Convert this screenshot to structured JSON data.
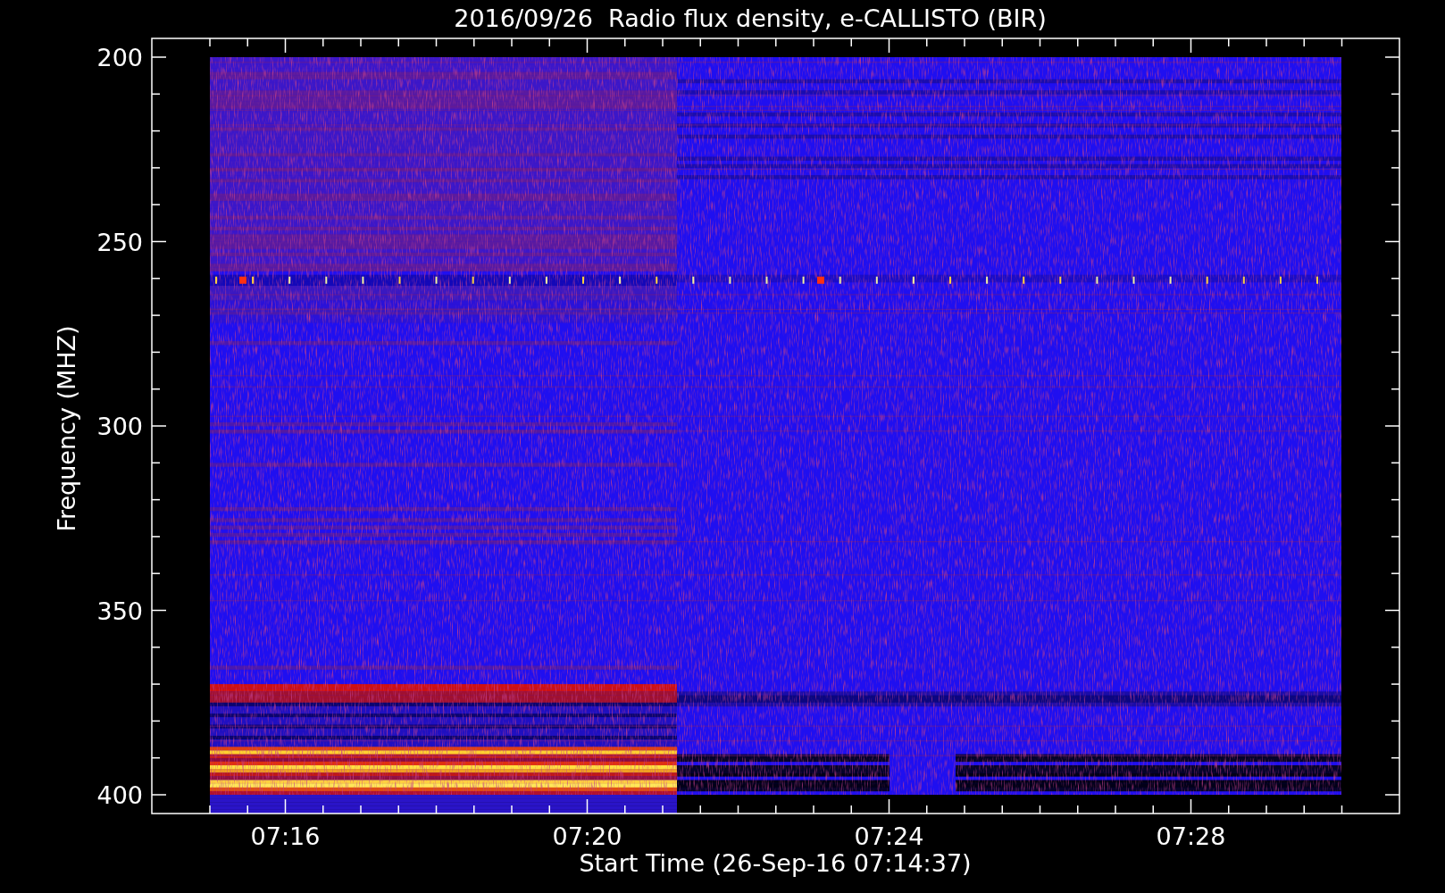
{
  "title": "2016/09/26  Radio flux density, e-CALLISTO (BIR)",
  "yaxis": {
    "label": "Frequency (MHZ)",
    "ticks": [
      "200",
      "250",
      "300",
      "350",
      "400"
    ]
  },
  "xaxis": {
    "label": "Start Time (26-Sep-16 07:14:37)",
    "ticks": [
      "07:16",
      "07:20",
      "07:24",
      "07:28"
    ]
  }
}
